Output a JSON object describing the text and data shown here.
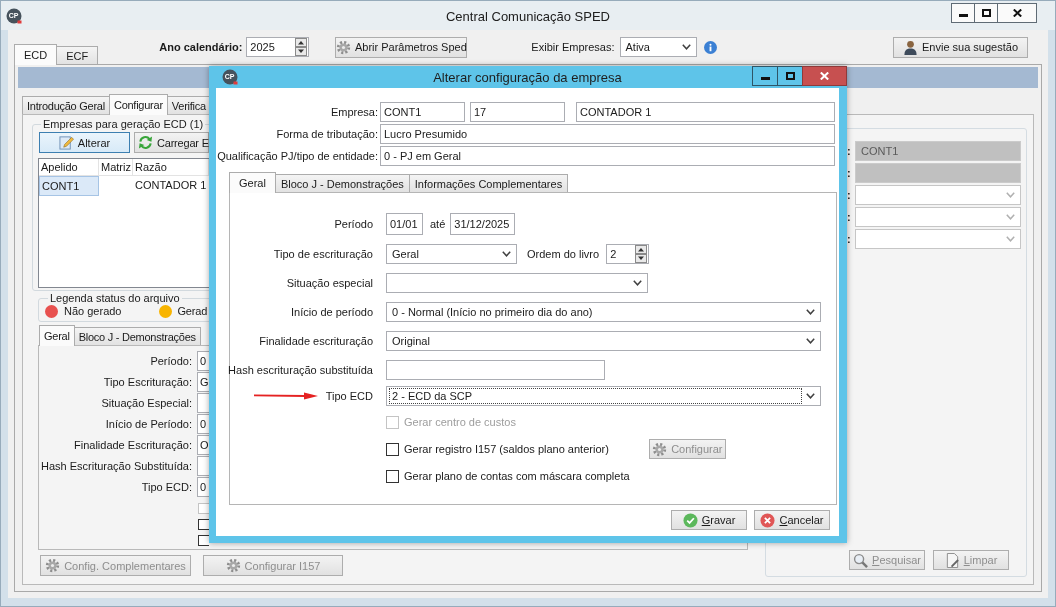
{
  "window": {
    "app_icon": "CP",
    "title": "Central Comunicação SPED"
  },
  "top_tabs": [
    {
      "label": "ECD",
      "selected": true
    },
    {
      "label": "ECF",
      "selected": false
    }
  ],
  "toolbar": {
    "year_label": "Ano calendário:",
    "year": "2025",
    "params_button": "Abrir Parâmetros Sped",
    "filter_label": "Exibir Empresas:",
    "filter": "Ativa",
    "suggestion_button": "Envie sua sugestão"
  },
  "inner_tabs": [
    {
      "label": "Introdução Geral",
      "selected": false
    },
    {
      "label": "Configurar",
      "selected": true
    },
    {
      "label": "Verifica",
      "selected": false
    }
  ],
  "companies": {
    "title": "Empresas para geração ECD (1)",
    "buttons": [
      {
        "label": "Alterar",
        "kind": "edit",
        "focused": true
      },
      {
        "label": "Carregar E",
        "kind": "reload",
        "focused": false
      }
    ],
    "columns": [
      "Apelido",
      "Matriz",
      "Razão"
    ],
    "rows": [
      {
        "apelido": "CONT1",
        "razao": "CONTADOR 1",
        "selected": true
      }
    ]
  },
  "legend": {
    "title": "Legenda status do arquivo",
    "items": [
      {
        "label": "Não gerado",
        "color": "#e8514f"
      },
      {
        "label": "Gerad",
        "color": "#f8b400"
      }
    ]
  },
  "detail_tabs": [
    {
      "label": "Geral",
      "selected": true
    },
    {
      "label": "Bloco J - Demonstrações",
      "selected": false
    }
  ],
  "detail_form": {
    "fields": [
      {
        "label": "Período:",
        "value": "0"
      },
      {
        "label": "Tipo Escrituração:",
        "value": "G"
      },
      {
        "label": "Situação Especial:"
      },
      {
        "label": "Início de Período:",
        "value": "0"
      },
      {
        "label": "Finalidade Escrituração:",
        "value": "O"
      },
      {
        "label": "Hash Escrituração Substituída:"
      },
      {
        "label": "Tipo ECD:",
        "value": "0"
      }
    ],
    "checkboxes": [
      {
        "checked": false,
        "disabled": true
      },
      {
        "checked": false,
        "disabled": false
      },
      {
        "checked": false,
        "disabled": false
      }
    ]
  },
  "bottom_buttons": [
    {
      "label": "Config. Complementares",
      "disabled": true
    },
    {
      "label": "Configurar I157",
      "disabled": true
    }
  ],
  "search_panel": {
    "fields": [
      {
        "label": ":",
        "kind": "readonly",
        "value": "CONT1"
      },
      {
        "label": ":",
        "kind": "readonly"
      },
      {
        "label": ":",
        "kind": "select"
      },
      {
        "label": ":",
        "kind": "select"
      },
      {
        "label": ":",
        "kind": "select"
      }
    ],
    "buttons": [
      {
        "label": "Pesquisar",
        "kind": "search",
        "disabled": true
      },
      {
        "label": "Limpar",
        "kind": "clear",
        "disabled": true
      }
    ]
  },
  "dialog": {
    "app_icon": "CP",
    "title": "Alterar configuração da empresa",
    "header": [
      {
        "label": "Empresa:",
        "values": [
          "CONT1",
          "17",
          "CONTADOR 1"
        ]
      },
      {
        "label": "Forma de tributação:",
        "values": [
          "Lucro Presumido"
        ]
      },
      {
        "label": "Qualificação PJ/tipo de entidade:",
        "values": [
          "0 - PJ em Geral"
        ]
      }
    ],
    "tabs": [
      {
        "label": "Geral",
        "selected": true
      },
      {
        "label": "Bloco J - Demonstrações",
        "selected": false
      },
      {
        "label": "Informações Complementares",
        "selected": false
      }
    ],
    "period": {
      "label": "Período",
      "from": "01/01",
      "separator": "até",
      "to": "31/12/2025"
    },
    "rows": [
      {
        "kind": "select",
        "label": "Tipo de escrituração",
        "value": "Geral",
        "focused": false,
        "annotated": false,
        "extra": {
          "label": "Ordem do livro",
          "value": "2"
        }
      },
      {
        "kind": "select",
        "label": "Situação especial",
        "focused": false,
        "annotated": false
      },
      {
        "kind": "select",
        "label": "Início de período",
        "value": "0 - Normal (Início no primeiro dia do ano)",
        "focused": false,
        "annotated": false
      },
      {
        "kind": "select",
        "label": "Finalidade escrituração",
        "value": "Original",
        "focused": false,
        "annotated": false
      },
      {
        "kind": "input",
        "label": "Hash escrituração substituída",
        "focused": false,
        "annotated": false
      },
      {
        "kind": "select",
        "label": "Tipo ECD",
        "value": "2 - ECD da SCP",
        "focused": true,
        "annotated": true
      }
    ],
    "checkboxes": [
      {
        "label": "Gerar centro de custos",
        "checked": false,
        "disabled": true
      },
      {
        "label": "Gerar registro I157 (saldos plano anterior)",
        "checked": false,
        "disabled": false,
        "button": {
          "label": "Configurar",
          "disabled": true
        }
      },
      {
        "label": "Gerar plano de contas com máscara completa",
        "checked": false,
        "disabled": false
      }
    ],
    "buttons": [
      {
        "label": "Gravar",
        "kind": "ok"
      },
      {
        "label": "Cancelar",
        "kind": "cancel"
      }
    ]
  }
}
